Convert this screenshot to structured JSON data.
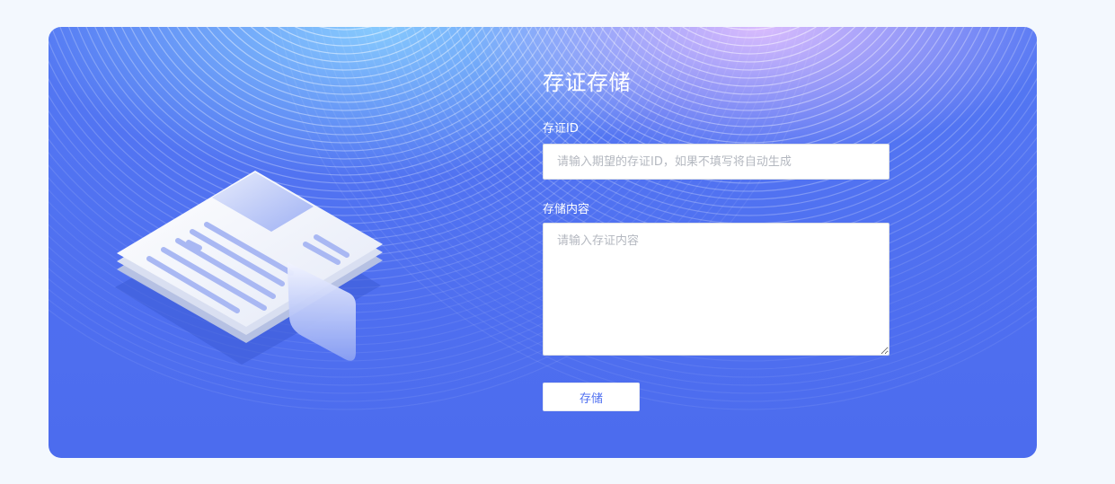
{
  "form": {
    "title": "存证存储",
    "evidence_id_label": "存证ID",
    "evidence_id_value": "",
    "evidence_id_placeholder": "请输入期望的存证ID，如果不填写将自动生成",
    "content_label": "存储内容",
    "content_value": "",
    "content_placeholder": "请输入存证内容",
    "save_label": "存储"
  },
  "colors": {
    "page_background": "#f3f8fe",
    "card_background": "#4f6ff0",
    "button_text": "#4f6ff0"
  },
  "icons": [
    "document-illustration",
    "resize-handle-icon"
  ]
}
